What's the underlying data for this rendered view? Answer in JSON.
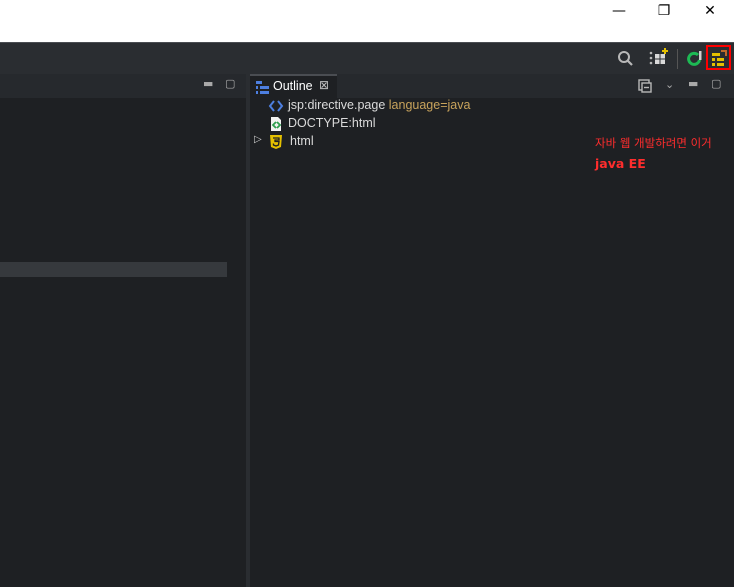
{
  "window": {
    "minimize_glyph": "—",
    "restore_glyph": "❐",
    "close_glyph": "✕"
  },
  "toolbar": {
    "icons": [
      "search-icon",
      "open-perspective-icon",
      "git-icon",
      "java-ee-perspective-icon"
    ]
  },
  "outline": {
    "tab_label": "Outline",
    "tab_close": "⊠",
    "items": [
      {
        "tag": "jsp:directive.page",
        "attr": "language=java",
        "icon": "code-brackets-icon"
      },
      {
        "tag": "DOCTYPE:html",
        "attr": "",
        "icon": "doctype-icon"
      },
      {
        "tag": "html",
        "attr": "",
        "icon": "html5-icon",
        "expandable": true
      }
    ]
  },
  "annotation": {
    "line1": "자바 웹 개발하려면 이거",
    "line2": "java EE",
    "color": "#ff2d2d"
  },
  "colors": {
    "background": "#1e2023",
    "toolbar": "#2a2d31",
    "highlight_box": "#ff0000",
    "accent_blue": "#4d7fe0",
    "html5_yellow": "#e5c100",
    "attr_orange": "#c8a35c"
  }
}
